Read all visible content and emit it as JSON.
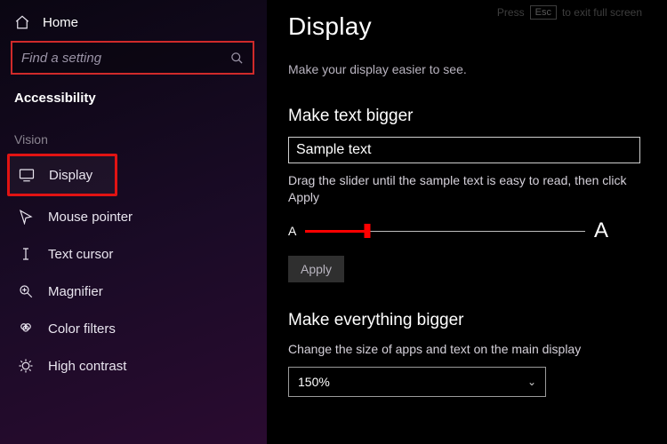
{
  "sidebar": {
    "home": "Home",
    "search_placeholder": "Find a setting",
    "category": "Accessibility",
    "group": "Vision",
    "items": [
      {
        "label": "Display"
      },
      {
        "label": "Mouse pointer"
      },
      {
        "label": "Text cursor"
      },
      {
        "label": "Magnifier"
      },
      {
        "label": "Color filters"
      },
      {
        "label": "High contrast"
      }
    ]
  },
  "hint": {
    "press": "Press",
    "key": "Esc",
    "rest": "to exit full screen"
  },
  "main": {
    "title": "Display",
    "subtitle": "Make your display easier to see.",
    "text_bigger": {
      "heading": "Make text bigger",
      "sample": "Sample text",
      "hint": "Drag the slider until the sample text is easy to read, then click Apply",
      "small_a": "A",
      "big_a": "A",
      "slider_pct": 22,
      "apply": "Apply"
    },
    "everything_bigger": {
      "heading": "Make everything bigger",
      "hint": "Change the size of apps and text on the main display",
      "value": "150%"
    }
  }
}
